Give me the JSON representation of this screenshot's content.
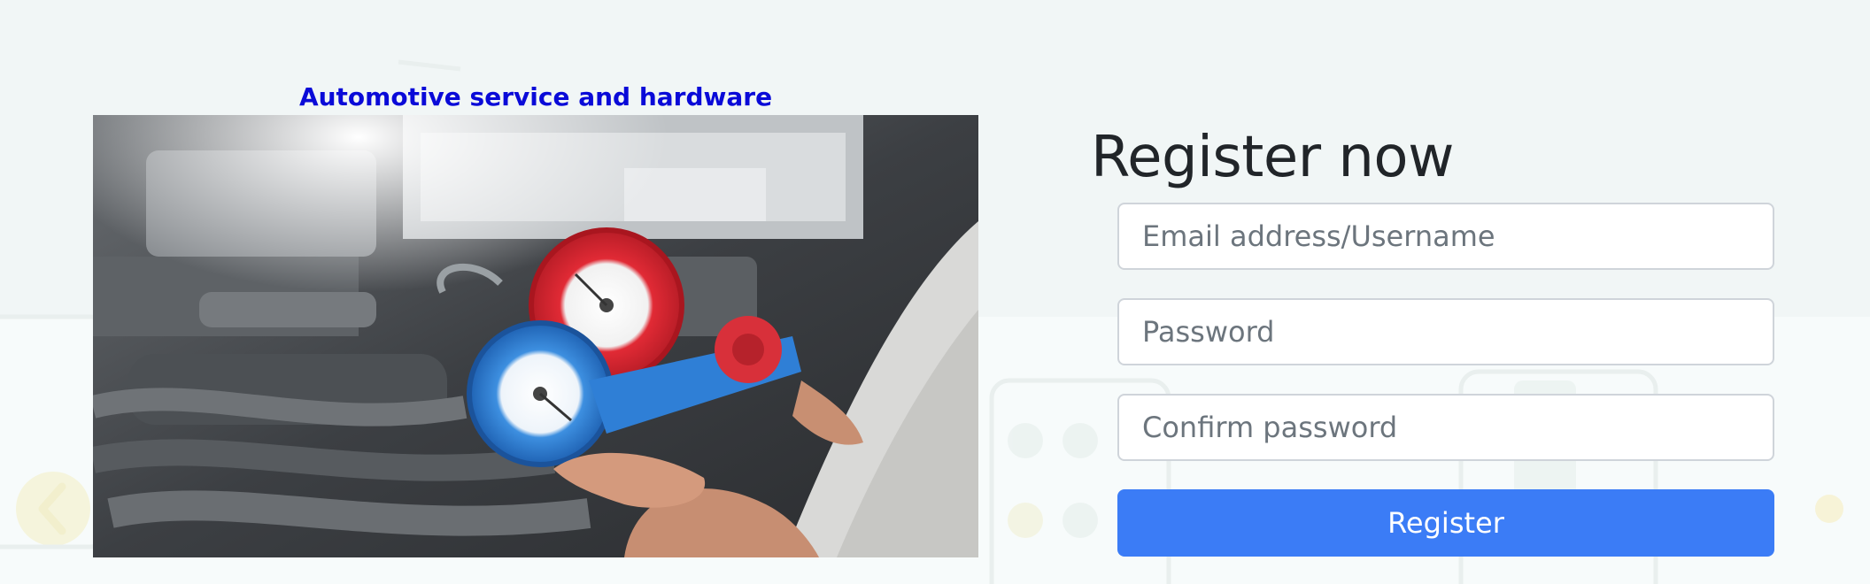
{
  "hero": {
    "caption": "Automotive service and hardware",
    "image_alt": "Mechanic holding refrigerant manifold gauges over a car engine"
  },
  "register_form": {
    "title": "Register now",
    "email_placeholder": "Email address/Username",
    "password_placeholder": "Password",
    "confirm_password_placeholder": "Confirm password",
    "submit_label": "Register"
  },
  "colors": {
    "caption": "#0a0ad8",
    "button": "#3b7cf6",
    "title": "#212529",
    "background": "#f3f7f7"
  },
  "icons": {
    "background_decoration": [
      "chevron-left-icon",
      "dashboard-icon",
      "bottle-icon"
    ]
  }
}
